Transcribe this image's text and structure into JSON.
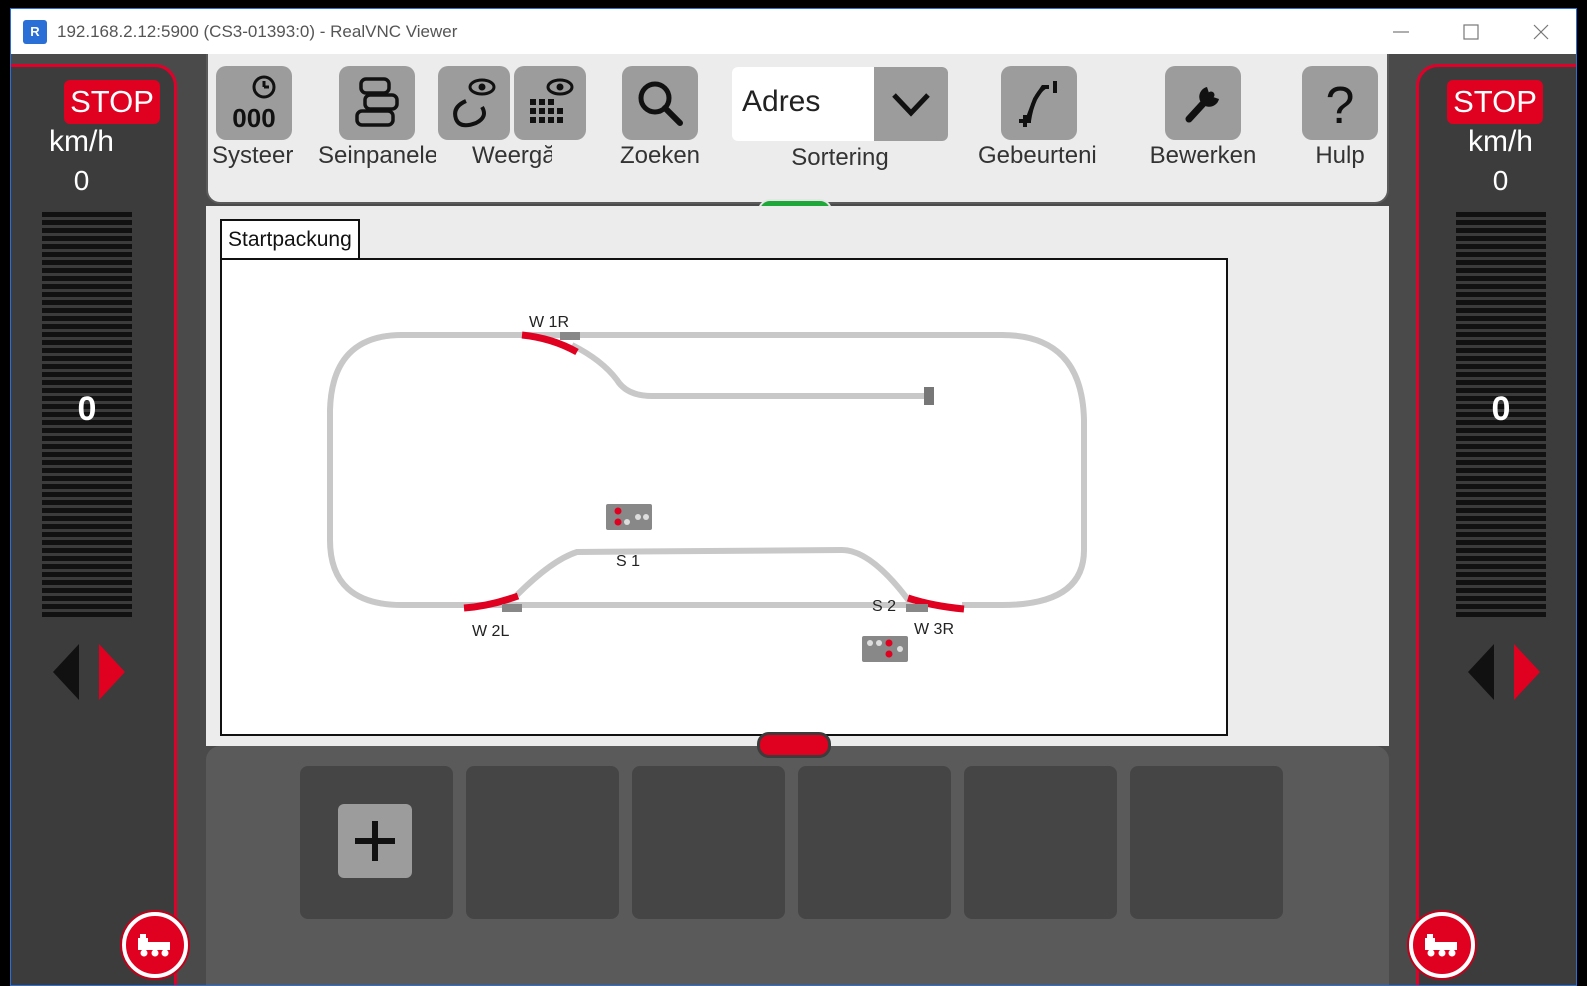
{
  "window": {
    "title": "192.168.2.12:5900 (CS3-01393:0) - RealVNC Viewer",
    "icon_text": "R"
  },
  "left_panel": {
    "stop_label": "STOP",
    "unit": "km/h",
    "speed": "0",
    "speedo_value": "0"
  },
  "right_panel": {
    "stop_label": "STOP",
    "unit": "km/h",
    "speed": "0",
    "speedo_value": "0"
  },
  "toolbar": {
    "systeem": "Systeer",
    "seinpaneel": "Seinpanele",
    "weergave": "Weergă",
    "zoeken": "Zoeken",
    "sortering_value": "Adres",
    "sortering_label": "Sortering",
    "gebeurtenis": "Gebeurteni",
    "bewerken": "Bewerken",
    "hulp": "Hulp"
  },
  "layout_tab": {
    "label": "Startpackung"
  },
  "track_labels": {
    "w1r": "W 1R",
    "w2l": "W 2L",
    "w3r": "W 3R",
    "s1": "S 1",
    "s2": "S 2"
  },
  "colors": {
    "accent_red": "#e0001f",
    "handle_green": "#1ea83a",
    "track_gray": "#c8c8c8",
    "panel_dark": "#3c3c3c"
  },
  "icons": {
    "systeem": "clock-counter-icon",
    "seinpaneel": "layout-panel-icon",
    "weergave_1": "eye-track-icon",
    "weergave_2": "eye-keypad-icon",
    "zoeken": "search-icon",
    "sortering": "chevron-down-icon",
    "gebeurtenis": "event-curve-icon",
    "bewerken": "wrench-icon",
    "hulp": "question-icon",
    "add": "plus-icon",
    "loco": "locomotive-icon"
  }
}
